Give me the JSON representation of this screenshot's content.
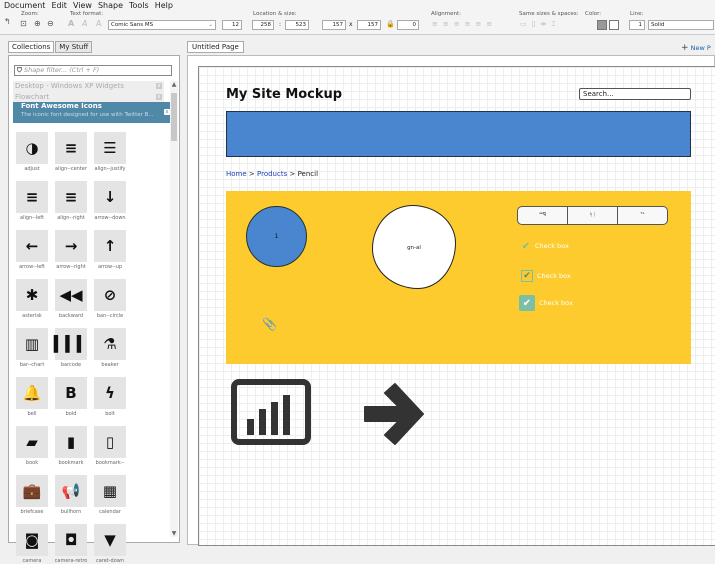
{
  "menu": [
    "Document",
    "Edit",
    "View",
    "Shape",
    "Tools",
    "Help"
  ],
  "toolbar": {
    "zoom_label": "Zoom:",
    "text_format_label": "Text format:",
    "font_name": "Comic Sans MS",
    "font_size": "12",
    "location_label": "Location & size:",
    "x": "258",
    "y": "523",
    "w": "157",
    "h": "157",
    "angle": "0",
    "times": "x",
    "alignment_label": "Alignment:",
    "same_sizes_label": "Same sizes & spaces:",
    "color_label": "Color:",
    "line_label": "Line:",
    "line_width": "1",
    "line_style": "Solid"
  },
  "left_tabs": [
    "Collections",
    "My Stuff"
  ],
  "filter_placeholder": "Shape filter... (Ctrl + F)",
  "libraries": [
    "Desktop - Windows XP Widgets",
    "Flowchart"
  ],
  "active_library": {
    "title": "Font Awesome Icons",
    "desc": "The iconic font designed for use with Twitter B..."
  },
  "icons": [
    {
      "name": "adjust",
      "glyph": "◑"
    },
    {
      "name": "align--center",
      "glyph": "≡"
    },
    {
      "name": "align--justify",
      "glyph": "☰"
    },
    {
      "name": "align--left",
      "glyph": "≡"
    },
    {
      "name": "align--right",
      "glyph": "≡"
    },
    {
      "name": "arrow--down",
      "glyph": "↓"
    },
    {
      "name": "arrow--left",
      "glyph": "←"
    },
    {
      "name": "arrow--right",
      "glyph": "→"
    },
    {
      "name": "arrow--up",
      "glyph": "↑"
    },
    {
      "name": "asterisk",
      "glyph": "✱"
    },
    {
      "name": "backward",
      "glyph": "◀◀"
    },
    {
      "name": "ban--circle",
      "glyph": "⊘"
    },
    {
      "name": "bar--chart",
      "glyph": "▥"
    },
    {
      "name": "barcode",
      "glyph": "▍▍▍"
    },
    {
      "name": "beaker",
      "glyph": "⚗"
    },
    {
      "name": "bell",
      "glyph": "🔔"
    },
    {
      "name": "bold",
      "glyph": "B"
    },
    {
      "name": "bolt",
      "glyph": "ϟ"
    },
    {
      "name": "book",
      "glyph": "▰"
    },
    {
      "name": "bookmark",
      "glyph": "▮"
    },
    {
      "name": "bookmark--",
      "glyph": "▯"
    },
    {
      "name": "briefcase",
      "glyph": "💼"
    },
    {
      "name": "bullhorn",
      "glyph": "📢"
    },
    {
      "name": "calendar",
      "glyph": "▦"
    },
    {
      "name": "camera",
      "glyph": "◙"
    },
    {
      "name": "camera-retro",
      "glyph": "◘"
    },
    {
      "name": "caret-down",
      "glyph": "▼"
    }
  ],
  "page_tab": "Untitled Page",
  "new_page": "New P",
  "mockup": {
    "title": "My Site Mockup",
    "search": "Search...",
    "crumb_home": "Home",
    "crumb_sep": " > ",
    "crumb_products": "Products",
    "crumb_current": "Pencil",
    "circle_text": "1",
    "blob_text": "gn-al",
    "segments": [
      "ꟹꟼ",
      "ᛋᛁ",
      "ᵀᴸ"
    ],
    "checkboxes": [
      "Check box",
      "Check box",
      "Check box"
    ]
  },
  "colors": {
    "banner": "#4a86cf",
    "yellow": "#fecb2f",
    "library_active": "#5088a7",
    "check_teal": "#7bbfa4"
  }
}
